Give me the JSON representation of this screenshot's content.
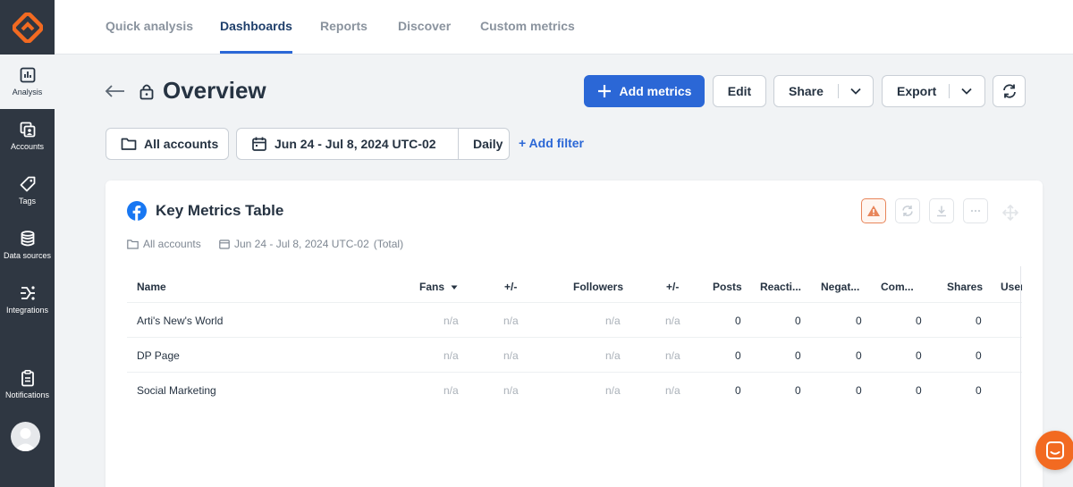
{
  "sidebar": {
    "items": [
      {
        "label": "Analysis",
        "icon": "bar-chart-icon"
      },
      {
        "label": "Accounts",
        "icon": "accounts-icon"
      },
      {
        "label": "Tags",
        "icon": "tag-icon"
      },
      {
        "label": "Data sources",
        "icon": "database-icon"
      },
      {
        "label": "Integrations",
        "icon": "integrations-icon"
      },
      {
        "label": "Notifications",
        "icon": "clipboard-icon"
      }
    ]
  },
  "topnav": {
    "tabs": [
      {
        "label": "Quick analysis"
      },
      {
        "label": "Dashboards"
      },
      {
        "label": "Reports"
      },
      {
        "label": "Discover"
      },
      {
        "label": "Custom metrics"
      }
    ],
    "active_tab": "Dashboards"
  },
  "header": {
    "title": "Overview",
    "add_metrics_label": "Add metrics",
    "edit_label": "Edit",
    "share_label": "Share",
    "export_label": "Export"
  },
  "filters": {
    "accounts_label": "All accounts",
    "date_range": "Jun 24 - Jul 8, 2024 UTC-02",
    "granularity": "Daily",
    "add_filter_label": "+ Add filter"
  },
  "card": {
    "title": "Key Metrics Table",
    "meta_accounts": "All accounts",
    "meta_date": "Jun 24 - Jul 8, 2024 UTC-02",
    "meta_total": "(Total)",
    "columns": [
      "Name",
      "Fans",
      "+/-",
      "Followers",
      "+/-",
      "Posts",
      "Reacti...",
      "Negat...",
      "Com...",
      "Shares",
      "User"
    ],
    "rows": [
      {
        "name": "Arti's New's World",
        "fans": "n/a",
        "fans_delta": "n/a",
        "followers": "n/a",
        "followers_delta": "n/a",
        "posts": "0",
        "reactions": "0",
        "negative": "0",
        "comments": "0",
        "shares": "0"
      },
      {
        "name": "DP Page",
        "fans": "n/a",
        "fans_delta": "n/a",
        "followers": "n/a",
        "followers_delta": "n/a",
        "posts": "0",
        "reactions": "0",
        "negative": "0",
        "comments": "0",
        "shares": "0"
      },
      {
        "name": "Social Marketing",
        "fans": "n/a",
        "fans_delta": "n/a",
        "followers": "n/a",
        "followers_delta": "n/a",
        "posts": "0",
        "reactions": "0",
        "negative": "0",
        "comments": "0",
        "shares": "0"
      }
    ]
  },
  "colors": {
    "sidebar_bg": "#2f3742",
    "brand_orange": "#f26a21",
    "primary_blue": "#2b67d6",
    "facebook_blue": "#1877f2"
  }
}
